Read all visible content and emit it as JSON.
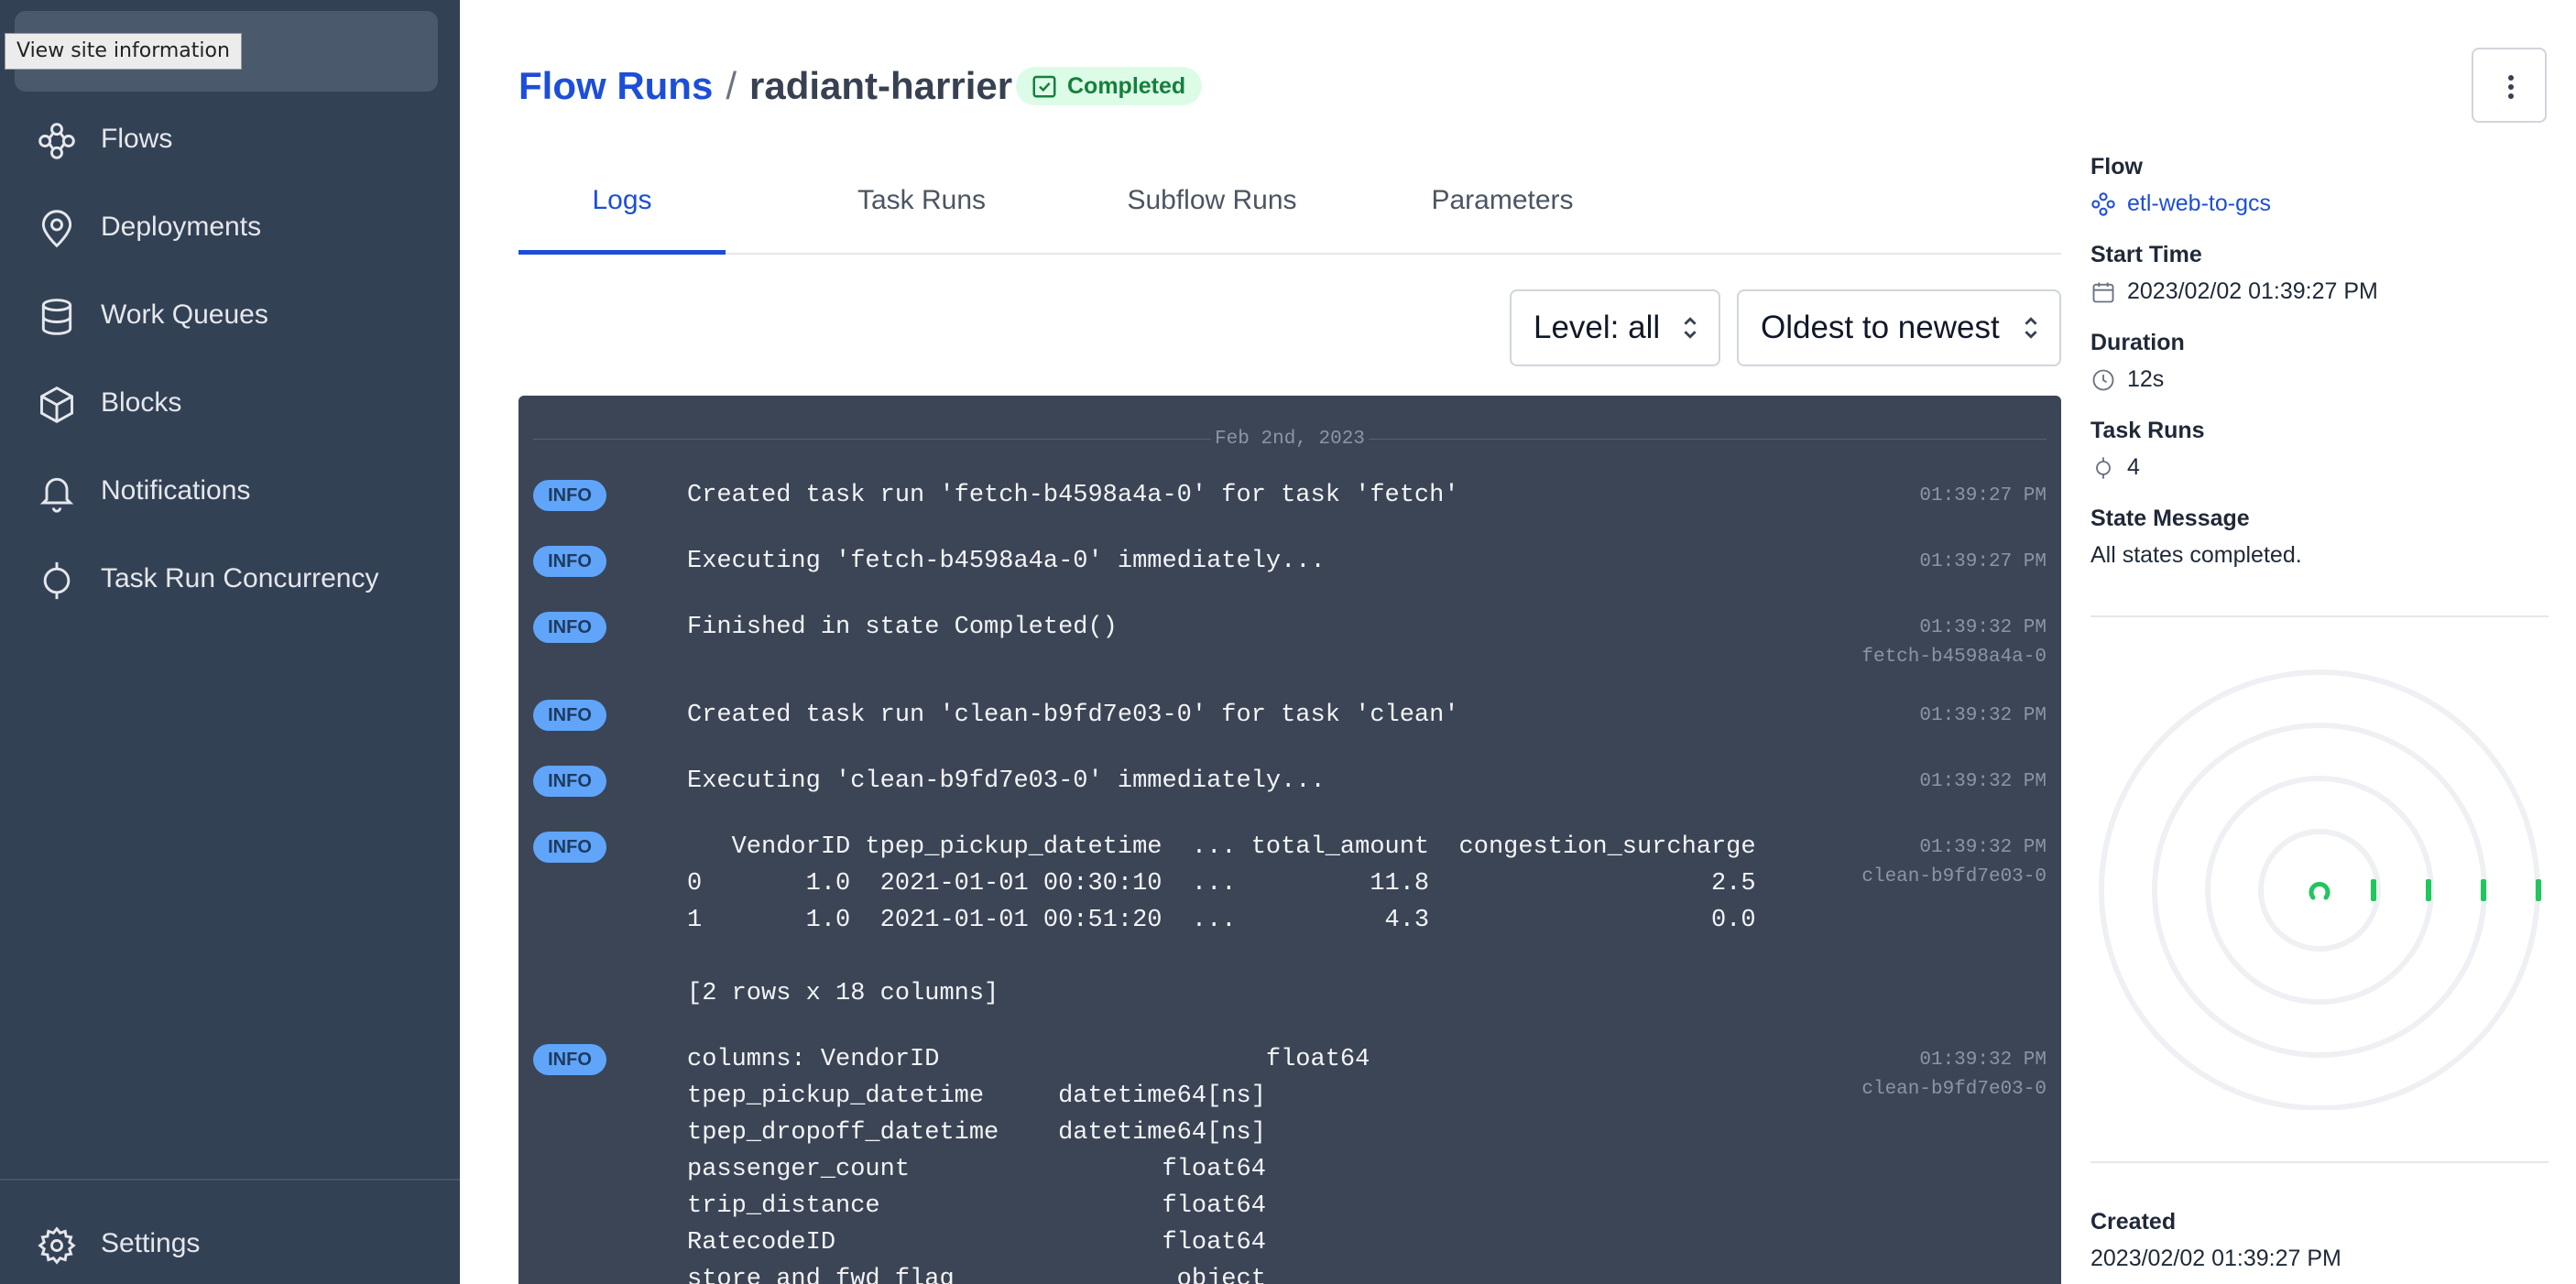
{
  "browser": {
    "tooltip": "View site information"
  },
  "sidebar": {
    "items": [
      {
        "label": "Flows",
        "icon": "flows-icon"
      },
      {
        "label": "Deployments",
        "icon": "map-pin-icon"
      },
      {
        "label": "Work Queues",
        "icon": "database-icon"
      },
      {
        "label": "Blocks",
        "icon": "cube-icon"
      },
      {
        "label": "Notifications",
        "icon": "bell-icon"
      },
      {
        "label": "Task Run Concurrency",
        "icon": "task-run-icon"
      }
    ],
    "settings": {
      "label": "Settings",
      "icon": "gear-icon"
    }
  },
  "header": {
    "breadcrumb_root": "Flow Runs",
    "separator": "/",
    "run_name": "radiant-harrier",
    "status": "Completed",
    "status_color": "#15803d"
  },
  "tabs": [
    {
      "label": "Logs",
      "active": true
    },
    {
      "label": "Task Runs",
      "active": false
    },
    {
      "label": "Subflow Runs",
      "active": false
    },
    {
      "label": "Parameters",
      "active": false
    }
  ],
  "filters": {
    "level": "Level: all",
    "order": "Oldest to newest"
  },
  "logs": {
    "date": "Feb 2nd, 2023",
    "entries": [
      {
        "level": "INFO",
        "message": "Created task run 'fetch-b4598a4a-0' for task 'fetch'",
        "time": "01:39:27 PM",
        "task": ""
      },
      {
        "level": "INFO",
        "message": "Executing 'fetch-b4598a4a-0' immediately...",
        "time": "01:39:27 PM",
        "task": ""
      },
      {
        "level": "INFO",
        "message": "Finished in state Completed()",
        "time": "01:39:32 PM",
        "task": "fetch-b4598a4a-0"
      },
      {
        "level": "INFO",
        "message": "Created task run 'clean-b9fd7e03-0' for task 'clean'",
        "time": "01:39:32 PM",
        "task": ""
      },
      {
        "level": "INFO",
        "message": "Executing 'clean-b9fd7e03-0' immediately...",
        "time": "01:39:32 PM",
        "task": ""
      },
      {
        "level": "INFO",
        "message": "   VendorID tpep_pickup_datetime  ... total_amount  congestion_surcharge\n0       1.0  2021-01-01 00:30:10  ...         11.8                   2.5\n1       1.0  2021-01-01 00:51:20  ...          4.3                   0.0\n\n[2 rows x 18 columns]",
        "time": "01:39:32 PM",
        "task": "clean-b9fd7e03-0"
      },
      {
        "level": "INFO",
        "message": "columns: VendorID                      float64\ntpep_pickup_datetime     datetime64[ns]\ntpep_dropoff_datetime    datetime64[ns]\npassenger_count                 float64\ntrip_distance                   float64\nRatecodeID                      float64\nstore_and_fwd_flag               object",
        "time": "01:39:32 PM",
        "task": "clean-b9fd7e03-0"
      }
    ]
  },
  "details": {
    "flow_label": "Flow",
    "flow_value": "etl-web-to-gcs",
    "start_time_label": "Start Time",
    "start_time_value": "2023/02/02 01:39:27 PM",
    "duration_label": "Duration",
    "duration_value": "12s",
    "task_runs_label": "Task Runs",
    "task_runs_value": "4",
    "state_message_label": "State Message",
    "state_message_value": "All states completed.",
    "created_label": "Created",
    "created_value": "2023/02/02 01:39:27 PM"
  },
  "colors": {
    "sidebar_bg": "#334155",
    "accent": "#1d4ed8",
    "success": "#22c55e",
    "log_bg": "#3b4556",
    "info_badge": "#60a5fa"
  }
}
